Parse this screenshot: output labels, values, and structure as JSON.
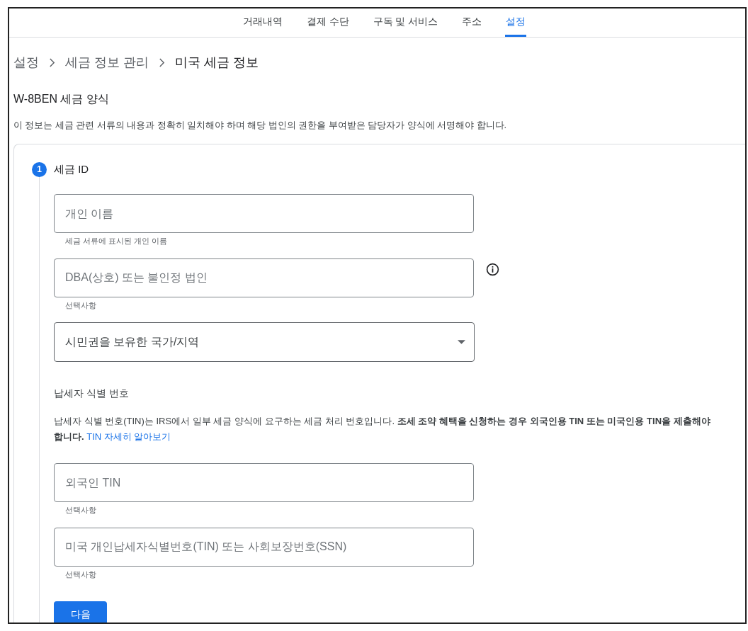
{
  "tabs": [
    {
      "label": "거래내역",
      "selected": false
    },
    {
      "label": "결제 수단",
      "selected": false
    },
    {
      "label": "구독 및 서비스",
      "selected": false
    },
    {
      "label": "주소",
      "selected": false
    },
    {
      "label": "설정",
      "selected": true
    }
  ],
  "breadcrumb": [
    "설정",
    "세금 정보 관리",
    "미국 세금 정보"
  ],
  "title": "W-8BEN 세금 양식",
  "description": "이 정보는 세금 관련 서류의 내용과 정확히 일치해야 하며 해당 법인의 권한을 부여받은 담당자가 양식에 서명해야 합니다.",
  "step": {
    "number": "1",
    "title": "세금 ID",
    "fields": [
      {
        "kind": "text",
        "placeholder": "개인 이름",
        "helper": "세금 서류에 표시된 개인 이름",
        "info": false
      },
      {
        "kind": "text",
        "placeholder": "DBA(상호) 또는 불인정 법인",
        "helper": "선택사항",
        "info": true
      },
      {
        "kind": "select",
        "placeholder": "시민권을 보유한 국가/지역",
        "info": false
      }
    ],
    "tin_section": {
      "heading": "납세자 식별 번호",
      "text": "납세자 식별 번호(TIN)는 IRS에서 일부 세금 양식에 요구하는 세금 처리 번호입니다. **조세 조약 혜택을 신청하는 경우 외국인용 TIN 또는 미국인용 TIN을 제출해야 합니다.**",
      "link": "TIN 자세히 알아보기"
    },
    "tin_fields": [
      {
        "kind": "text",
        "placeholder": "외국인 TIN",
        "helper": "선택사항",
        "info": false
      },
      {
        "kind": "text",
        "placeholder": "미국 개인납세자식별번호(TIN) 또는 사회보장번호(SSN)",
        "helper": "선택사항",
        "info": false
      }
    ],
    "button": "다음"
  }
}
